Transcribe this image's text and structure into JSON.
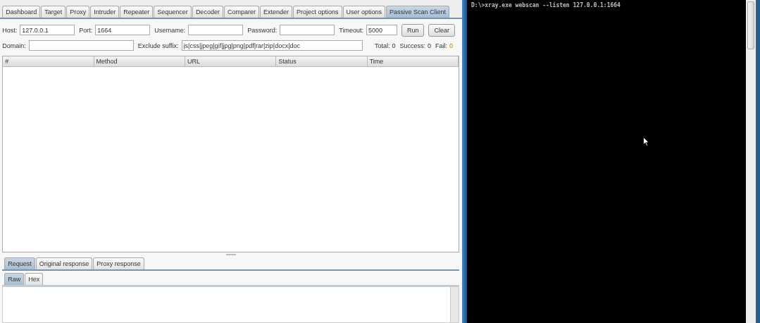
{
  "main_tabs": [
    {
      "label": "Dashboard",
      "selected": false
    },
    {
      "label": "Target",
      "selected": false
    },
    {
      "label": "Proxy",
      "selected": false
    },
    {
      "label": "Intruder",
      "selected": false
    },
    {
      "label": "Repeater",
      "selected": false
    },
    {
      "label": "Sequencer",
      "selected": false
    },
    {
      "label": "Decoder",
      "selected": false
    },
    {
      "label": "Comparer",
      "selected": false
    },
    {
      "label": "Extender",
      "selected": false
    },
    {
      "label": "Project options",
      "selected": false
    },
    {
      "label": "User options",
      "selected": false
    },
    {
      "label": "Passive Scan Client",
      "selected": true
    }
  ],
  "row1": [
    {
      "label": "Host:",
      "value": "127.0.0.1"
    },
    {
      "label": "Port:",
      "value": "1664"
    },
    {
      "label": "Username:"
    },
    {
      "label": "Password:"
    },
    {
      "label": "Timeout:",
      "value": "5000"
    }
  ],
  "buttons": [
    "Run",
    "Clear"
  ],
  "row2": [
    {
      "label": "Domain:"
    },
    {
      "label": "Exclude suffix:",
      "value": "js|css|jpeg|gif|jpg|png|pdf|rar|zip|docx|doc"
    }
  ],
  "stats": [
    {
      "label": "Total:",
      "value": "0",
      "kind": "normal"
    },
    {
      "label": "Success:",
      "value": "0",
      "kind": "normal"
    },
    {
      "label": "Fail:",
      "value": "0",
      "kind": "fail"
    }
  ],
  "table": {
    "columns": [
      "#",
      "Method",
      "URL",
      "Status",
      "Time"
    ]
  },
  "detail_tabs": [
    {
      "label": "Request",
      "selected": true
    },
    {
      "label": "Original response",
      "selected": false
    },
    {
      "label": "Proxy response",
      "selected": false
    }
  ],
  "view_tabs": [
    {
      "label": "Raw",
      "selected": true
    },
    {
      "label": "Hex",
      "selected": false
    }
  ],
  "console": {
    "lines": [
      "D:\\>xray.exe webscan --listen 127.0.0.1:1664"
    ]
  }
}
